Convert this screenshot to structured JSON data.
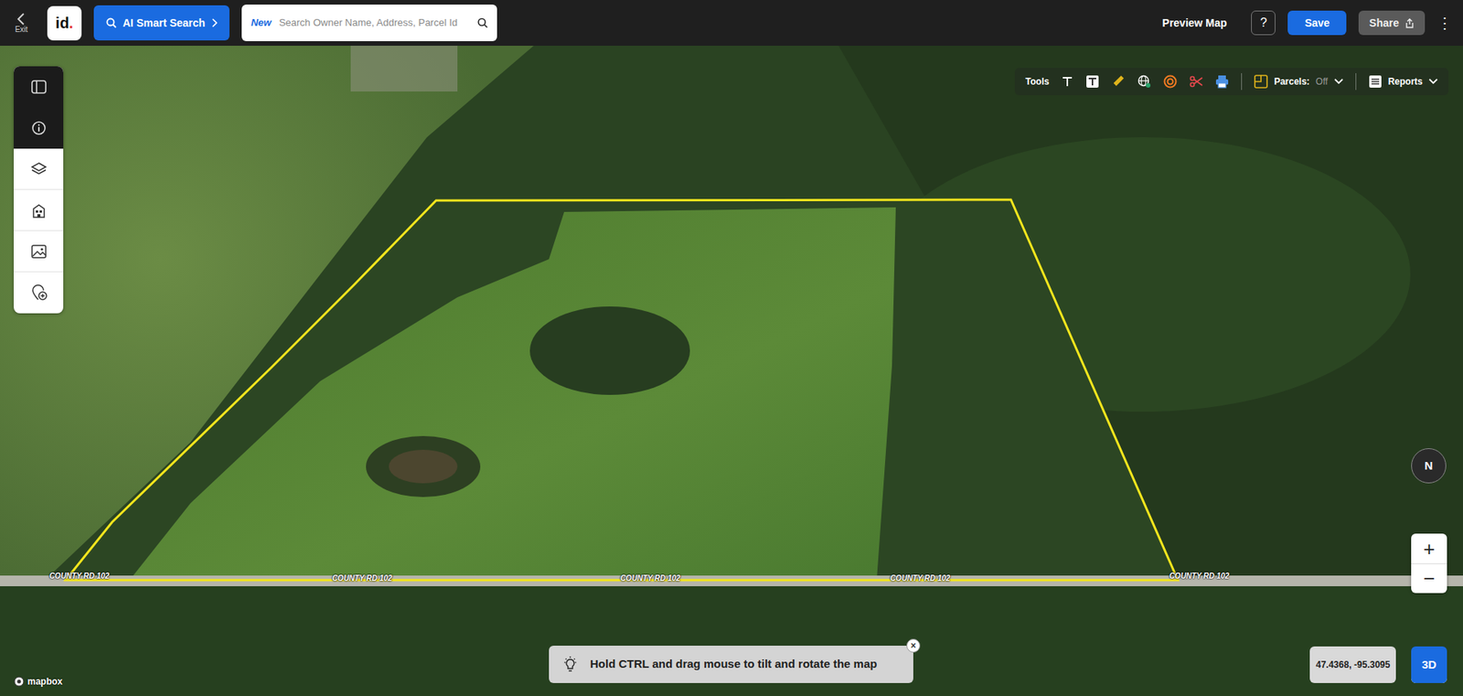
{
  "topbar": {
    "exit": "Exit",
    "logo": "id",
    "logo_dot": ".",
    "ai_search": "AI Smart Search",
    "search": {
      "badge": "New",
      "placeholder": "Search Owner Name, Address, Parcel Id"
    },
    "preview": "Preview Map",
    "help": "?",
    "save": "Save",
    "share": "Share",
    "more": "⋮"
  },
  "toolbar": {
    "label": "Tools",
    "parcels_label": "Parcels:",
    "parcels_state": "Off",
    "reports": "Reports"
  },
  "map": {
    "road_labels": [
      "COUNTY RD 102",
      "COUNTY RD 102",
      "COUNTY RD 102",
      "COUNTY RD 102",
      "COUNTY RD 102"
    ],
    "compass": "N",
    "zoom_in": "+",
    "zoom_out": "−",
    "coordinates": "47.4368, -95.3095",
    "view_3d": "3D",
    "attribution": "mapbox"
  },
  "hint": {
    "text": "Hold CTRL and drag mouse to tilt and rotate the map",
    "close": "×"
  }
}
